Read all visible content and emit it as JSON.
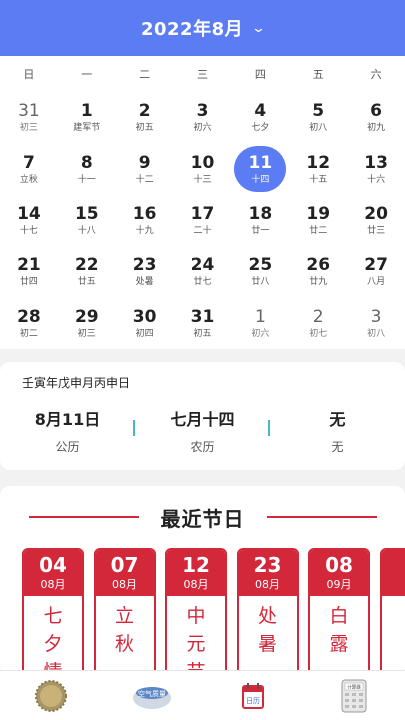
{
  "header": {
    "title": "2022年8月",
    "chevron_icon": "chevron-down-icon"
  },
  "calendar": {
    "weekdays": [
      "日",
      "一",
      "二",
      "三",
      "四",
      "五",
      "六"
    ],
    "days": [
      {
        "num": "31",
        "lunar": "初三",
        "other": true
      },
      {
        "num": "1",
        "lunar": "建军节",
        "other": false
      },
      {
        "num": "2",
        "lunar": "初五",
        "other": false
      },
      {
        "num": "3",
        "lunar": "初六",
        "other": false
      },
      {
        "num": "4",
        "lunar": "七夕",
        "other": false
      },
      {
        "num": "5",
        "lunar": "初八",
        "other": false
      },
      {
        "num": "6",
        "lunar": "初九",
        "other": false
      },
      {
        "num": "7",
        "lunar": "立秋",
        "other": false
      },
      {
        "num": "8",
        "lunar": "十一",
        "other": false
      },
      {
        "num": "9",
        "lunar": "十二",
        "other": false
      },
      {
        "num": "10",
        "lunar": "十三",
        "other": false
      },
      {
        "num": "11",
        "lunar": "十四",
        "other": false,
        "selected": true
      },
      {
        "num": "12",
        "lunar": "十五",
        "other": false
      },
      {
        "num": "13",
        "lunar": "十六",
        "other": false
      },
      {
        "num": "14",
        "lunar": "十七",
        "other": false
      },
      {
        "num": "15",
        "lunar": "十八",
        "other": false
      },
      {
        "num": "16",
        "lunar": "十九",
        "other": false
      },
      {
        "num": "17",
        "lunar": "二十",
        "other": false
      },
      {
        "num": "18",
        "lunar": "廿一",
        "other": false
      },
      {
        "num": "19",
        "lunar": "廿二",
        "other": false
      },
      {
        "num": "20",
        "lunar": "廿三",
        "other": false
      },
      {
        "num": "21",
        "lunar": "廿四",
        "other": false
      },
      {
        "num": "22",
        "lunar": "廿五",
        "other": false
      },
      {
        "num": "23",
        "lunar": "处暑",
        "other": false
      },
      {
        "num": "24",
        "lunar": "廿七",
        "other": false
      },
      {
        "num": "25",
        "lunar": "廿八",
        "other": false
      },
      {
        "num": "26",
        "lunar": "廿九",
        "other": false
      },
      {
        "num": "27",
        "lunar": "八月",
        "other": false
      },
      {
        "num": "28",
        "lunar": "初二",
        "other": false
      },
      {
        "num": "29",
        "lunar": "初三",
        "other": false
      },
      {
        "num": "30",
        "lunar": "初四",
        "other": false
      },
      {
        "num": "31",
        "lunar": "初五",
        "other": false
      },
      {
        "num": "1",
        "lunar": "初六",
        "other": true
      },
      {
        "num": "2",
        "lunar": "初七",
        "other": true
      },
      {
        "num": "3",
        "lunar": "初八",
        "other": true
      }
    ]
  },
  "info": {
    "ganzhi": "壬寅年戊申月丙申日",
    "solar": {
      "value": "8月11日",
      "label": "公历"
    },
    "lunar": {
      "value": "七月十四",
      "label": "农历"
    },
    "festival": {
      "value": "无",
      "label": "无"
    }
  },
  "festivals": {
    "title": "最近节日",
    "cards": [
      {
        "day": "04",
        "month": "08月",
        "name": "七夕情"
      },
      {
        "day": "07",
        "month": "08月",
        "name": "立秋"
      },
      {
        "day": "12",
        "month": "08月",
        "name": "中元节"
      },
      {
        "day": "23",
        "month": "08月",
        "name": "处暑"
      },
      {
        "day": "08",
        "month": "09月",
        "name": "白露"
      }
    ]
  },
  "tabbar": {
    "items": [
      {
        "icon": "fortune-badge-icon"
      },
      {
        "icon": "air-quality-icon",
        "label": "空气质量"
      },
      {
        "icon": "calendar-icon",
        "label": "日历"
      },
      {
        "icon": "calculator-icon",
        "label": "计算器"
      }
    ]
  },
  "colors": {
    "primary": "#5b7cf2",
    "festival_red": "#d3273a",
    "separator": "#46b8c8"
  }
}
